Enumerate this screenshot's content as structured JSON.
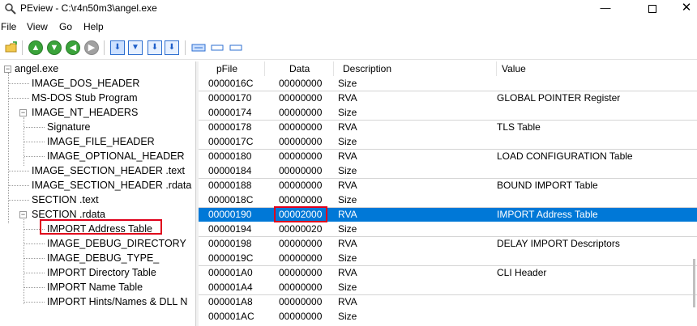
{
  "window": {
    "title": "PEview - C:\\r4n50m3\\angel.exe",
    "min_glyph": "—",
    "close_glyph": "✕"
  },
  "menu": [
    "File",
    "View",
    "Go",
    "Help"
  ],
  "toolbar": {
    "icons": [
      "open-folder-icon",
      "first-icon",
      "back-icon",
      "forward-icon",
      "last-icon",
      "view-hex-icon",
      "view-byte-icon",
      "view-down-icon",
      "view-save-icon",
      "list-view-icon",
      "detail-view-icon",
      "collapse-view-icon"
    ],
    "arrow_up": "▲",
    "arrow_down": "▼",
    "arrow_left": "◀",
    "arrow_right": "▶",
    "down_glyph": "⬇"
  },
  "tree": {
    "root": "angel.exe",
    "items": [
      "IMAGE_DOS_HEADER",
      "MS-DOS Stub Program",
      "IMAGE_NT_HEADERS",
      "Signature",
      "IMAGE_FILE_HEADER",
      "IMAGE_OPTIONAL_HEADER",
      "IMAGE_SECTION_HEADER .text",
      "IMAGE_SECTION_HEADER .rdata",
      "SECTION .text",
      "SECTION .rdata",
      "IMPORT Address Table",
      "IMAGE_DEBUG_DIRECTORY",
      "IMAGE_DEBUG_TYPE_",
      "IMPORT Directory Table",
      "IMPORT Name Table",
      "IMPORT Hints/Names & DLL N"
    ],
    "selected": "IMPORT Address Table"
  },
  "columns": [
    "pFile",
    "Data",
    "Description",
    "Value"
  ],
  "rows": [
    {
      "pfile": "0000016C",
      "data": "00000000",
      "desc": "Size",
      "value": ""
    },
    {
      "pfile": "00000170",
      "data": "00000000",
      "desc": "RVA",
      "value": "GLOBAL POINTER Register"
    },
    {
      "pfile": "00000174",
      "data": "00000000",
      "desc": "Size",
      "value": ""
    },
    {
      "pfile": "00000178",
      "data": "00000000",
      "desc": "RVA",
      "value": "TLS Table"
    },
    {
      "pfile": "0000017C",
      "data": "00000000",
      "desc": "Size",
      "value": ""
    },
    {
      "pfile": "00000180",
      "data": "00000000",
      "desc": "RVA",
      "value": "LOAD CONFIGURATION Table"
    },
    {
      "pfile": "00000184",
      "data": "00000000",
      "desc": "Size",
      "value": ""
    },
    {
      "pfile": "00000188",
      "data": "00000000",
      "desc": "RVA",
      "value": "BOUND IMPORT Table"
    },
    {
      "pfile": "0000018C",
      "data": "00000000",
      "desc": "Size",
      "value": ""
    },
    {
      "pfile": "00000190",
      "data": "00002000",
      "desc": "RVA",
      "value": "IMPORT Address Table"
    },
    {
      "pfile": "00000194",
      "data": "00000020",
      "desc": "Size",
      "value": ""
    },
    {
      "pfile": "00000198",
      "data": "00000000",
      "desc": "RVA",
      "value": "DELAY IMPORT Descriptors"
    },
    {
      "pfile": "0000019C",
      "data": "00000000",
      "desc": "Size",
      "value": ""
    },
    {
      "pfile": "000001A0",
      "data": "00000000",
      "desc": "RVA",
      "value": "CLI Header"
    },
    {
      "pfile": "000001A4",
      "data": "00000000",
      "desc": "Size",
      "value": ""
    },
    {
      "pfile": "000001A8",
      "data": "00000000",
      "desc": "RVA",
      "value": ""
    },
    {
      "pfile": "000001AC",
      "data": "00000000",
      "desc": "Size",
      "value": ""
    }
  ],
  "selected_row_pfile": "00000190",
  "colors": {
    "selection": "#0078d7",
    "highlight_box": "#e0001b"
  }
}
